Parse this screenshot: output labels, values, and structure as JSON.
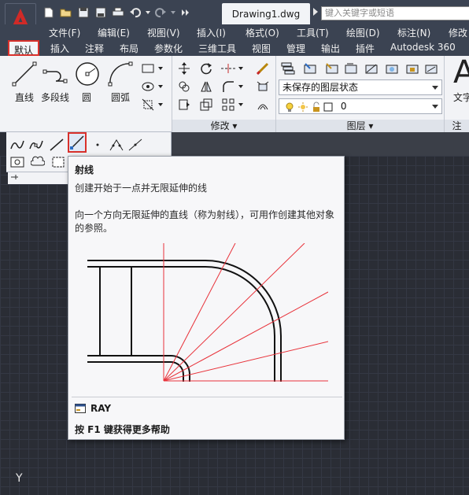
{
  "title_bar": {
    "document_tab": "Drawing1.dwg",
    "search_placeholder": "键入关键字或短语"
  },
  "menu": [
    "文件(F)",
    "编辑(E)",
    "视图(V)",
    "插入(I)",
    "格式(O)",
    "工具(T)",
    "绘图(D)",
    "标注(N)",
    "修改"
  ],
  "ribbon_tabs": [
    "默认",
    "插入",
    "注释",
    "布局",
    "参数化",
    "三维工具",
    "视图",
    "管理",
    "输出",
    "插件",
    "Autodesk 360"
  ],
  "draw_panel": {
    "line": "直线",
    "polyline": "多段线",
    "circle": "圆",
    "arc": "圆弧"
  },
  "modify_panel": {
    "label": "修改"
  },
  "layer_panel": {
    "label": "图层",
    "state_combo": "未保存的图层状态",
    "layer_combo": "0"
  },
  "text_panel": {
    "big_glyph": "A",
    "label": "文字"
  },
  "tooltip": {
    "title": "射线",
    "short_desc": "创建开始于一点并无限延伸的线",
    "long_desc": "向一个方向无限延伸的直线（称为射线），可用作创建其他对象的参照。",
    "command": "RAY",
    "help": "按 F1 键获得更多帮助"
  },
  "ucs_label": "Y",
  "colors": {
    "accent_red": "#d9312c",
    "ray_red": "#e8323a",
    "ribbon_bg": "#f2f3f6",
    "canvas_bg": "#2a2d35",
    "title_bg": "#3b4352"
  }
}
